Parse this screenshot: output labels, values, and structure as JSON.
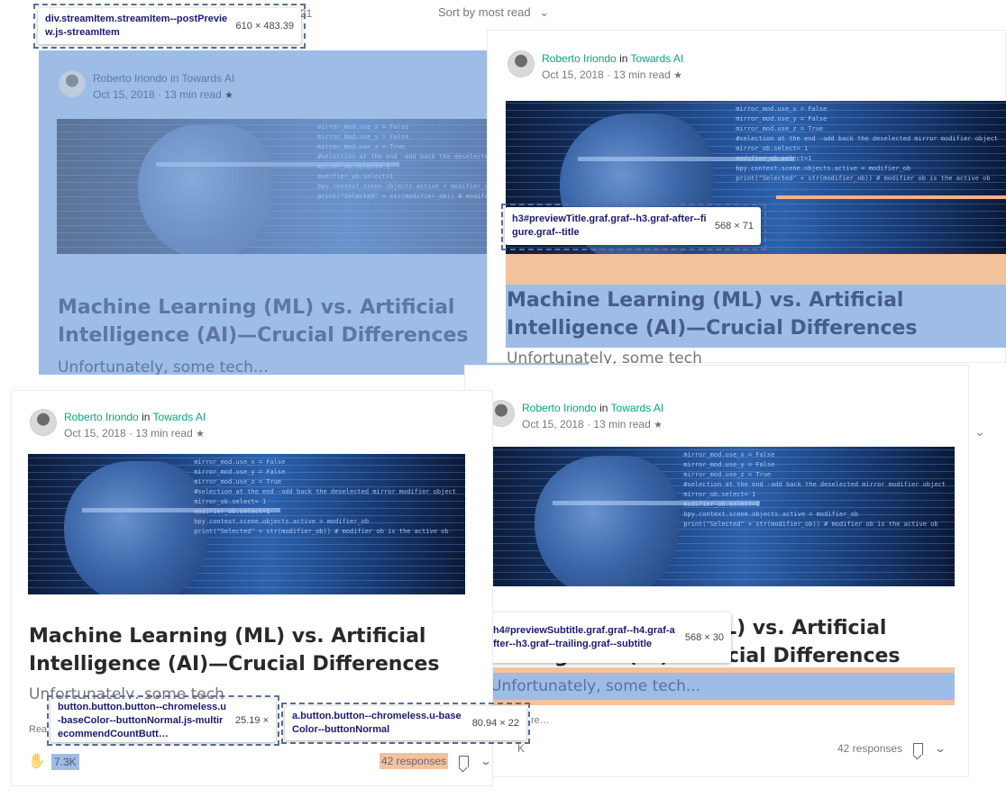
{
  "sort": {
    "label": "Sort by most read",
    "chevron": "⌄",
    "count_fragment": "21"
  },
  "article": {
    "author": "Roberto Iriondo",
    "in_word": "in",
    "publication": "Towards AI",
    "date": "Oct 15, 2018",
    "separator": "·",
    "read_time": "13 min read",
    "star": "★",
    "title": "Machine Learning (ML) vs. Artificial Intelligence (AI)—Crucial Differences",
    "subtitle_a": "Unfortunately, some tech…",
    "subtitle_b": "Unfortunately, some tech",
    "subtitle_c": "Unfortunately, some tech...",
    "read_more": "Read more…",
    "read_more_short": "Rea",
    "read_more_fragment": "re…",
    "claps": "7.3K",
    "claps_fragment": "K",
    "responses": "42 responses"
  },
  "code_lines": [
    "mirror_mod.use_x = False",
    "mirror_mod.use_y = False",
    "mirror_mod.use_z = True",
    "#selection at the end -add back the deselected mirror modifier object",
    "mirror_ob.select= 1",
    "modifier_ob.select=1",
    "bpy.context.scene.objects.active = modifier_ob",
    "print(\"Selected\" + str(modifier_ob)) # modifier ob is the active ob"
  ],
  "inspector": {
    "stream_item": {
      "selector": "div.streamItem.streamItem--postPreview.js-streamItem",
      "dims": "610 × 483.39"
    },
    "h3": {
      "selector": "h3#previewTitle.graf.graf--h3.graf-after--figure.graf--title",
      "dims": "568 × 71"
    },
    "h4": {
      "selector": "h4#previewSubtitle.graf.graf--h4.graf-after--h3.graf--trailing.graf--subtitle",
      "dims": "568 × 30"
    },
    "button": {
      "selector": "button.button.button--chromeless.u-baseColor--buttonNormal.js-multirecommendCountButt…",
      "dims": "25.19 ×"
    },
    "link": {
      "selector": "a.button.button--chromeless.u-baseColor--buttonNormal",
      "dims": "80.94 × 22"
    }
  },
  "icons": {
    "clap": "clap-icon",
    "bookmark": "bookmark-icon",
    "chevron": "chevron-down-icon",
    "star": "star-icon"
  }
}
